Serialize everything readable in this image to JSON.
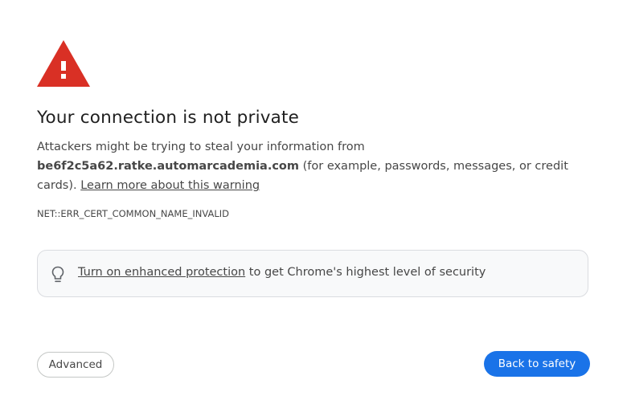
{
  "warning": {
    "icon": "warning-triangle-icon",
    "color": "#d93025"
  },
  "title": "Your connection is not private",
  "description": {
    "intro": "Attackers might be trying to steal your information from ",
    "host": "be6f2c5a62.ratke.automarcademia.com",
    "details": " (for example, passwords, messages, or credit cards). ",
    "learn_more": "Learn more about this warning"
  },
  "error_code": "NET::ERR_CERT_COMMON_NAME_INVALID",
  "enhanced_protection": {
    "icon": "lightbulb-icon",
    "link_text": "Turn on enhanced protection",
    "rest_text": " to get Chrome's highest level of security"
  },
  "buttons": {
    "advanced": "Advanced",
    "back_to_safety": "Back to safety"
  },
  "colors": {
    "primary_button": "#1a73e8",
    "text": "#474747",
    "heading": "#1f1f1f"
  }
}
